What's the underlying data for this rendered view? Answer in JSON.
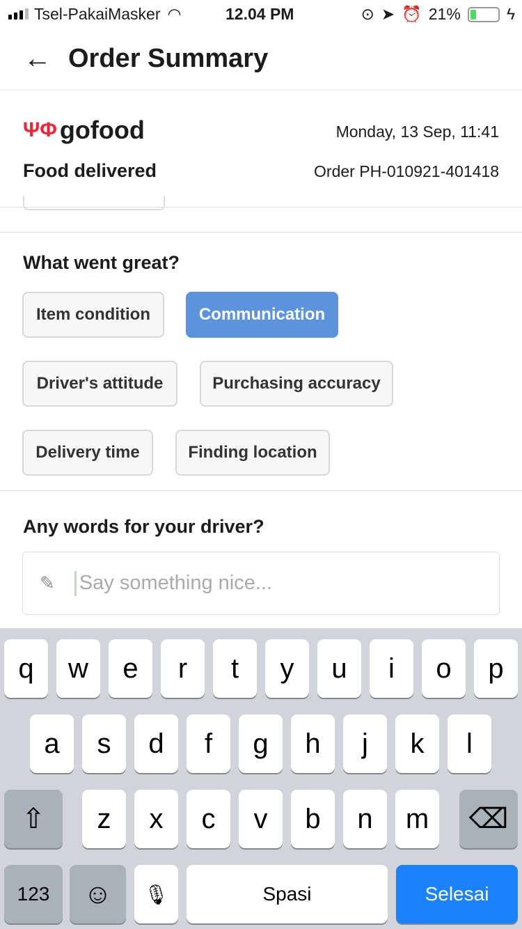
{
  "status": {
    "carrier": "Tsel-PakaiMasker",
    "time": "12.04 PM",
    "battery": "21%",
    "battery_level": 0.21
  },
  "header": {
    "title": "Order Summary"
  },
  "order": {
    "brand": "gofood",
    "date": "Monday, 13 Sep, 11:41",
    "status": "Food delivered",
    "order_id": "Order PH-010921-401418"
  },
  "great": {
    "title": "What went great?",
    "chips": [
      {
        "label": "Item condition",
        "selected": false
      },
      {
        "label": "Communication",
        "selected": true
      },
      {
        "label": "Driver's attitude",
        "selected": false
      },
      {
        "label": "Purchasing accuracy",
        "selected": false
      },
      {
        "label": "Delivery time",
        "selected": false
      },
      {
        "label": "Finding location",
        "selected": false
      }
    ]
  },
  "driver": {
    "title": "Any words for your driver?",
    "placeholder": "Say something nice..."
  },
  "keyboard": {
    "row1": [
      "q",
      "w",
      "e",
      "r",
      "t",
      "y",
      "u",
      "i",
      "o",
      "p"
    ],
    "row2": [
      "a",
      "s",
      "d",
      "f",
      "g",
      "h",
      "j",
      "k",
      "l"
    ],
    "row3": [
      "z",
      "x",
      "c",
      "v",
      "b",
      "n",
      "m"
    ],
    "numbers": "123",
    "space": "Spasi",
    "done": "Selesai",
    "shift_icon": "⇧",
    "delete_icon": "⌫",
    "emoji_icon": "☺",
    "mic_icon": "🎙"
  }
}
